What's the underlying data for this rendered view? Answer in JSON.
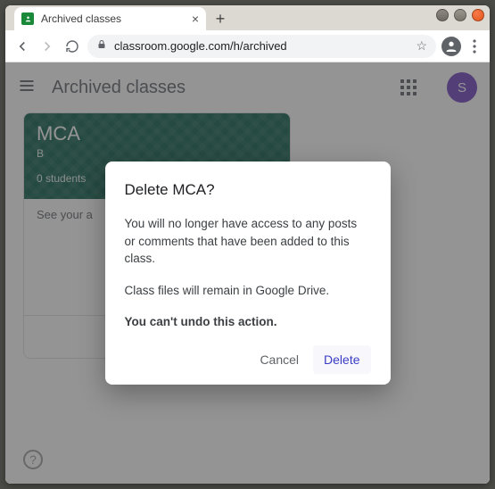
{
  "browser": {
    "tab_title": "Archived classes",
    "url": "classroom.google.com/h/archived"
  },
  "header": {
    "title": "Archived classes",
    "avatar_letter": "S"
  },
  "card": {
    "title": "MCA",
    "subtitle": "B",
    "students": "0 students",
    "body_text": "See your a"
  },
  "dialog": {
    "title": "Delete MCA?",
    "body1": "You will no longer have access to any posts or comments that have been added to this class.",
    "body2": "Class files will remain in Google Drive.",
    "body3": "You can't undo this action.",
    "cancel": "Cancel",
    "delete": "Delete"
  }
}
